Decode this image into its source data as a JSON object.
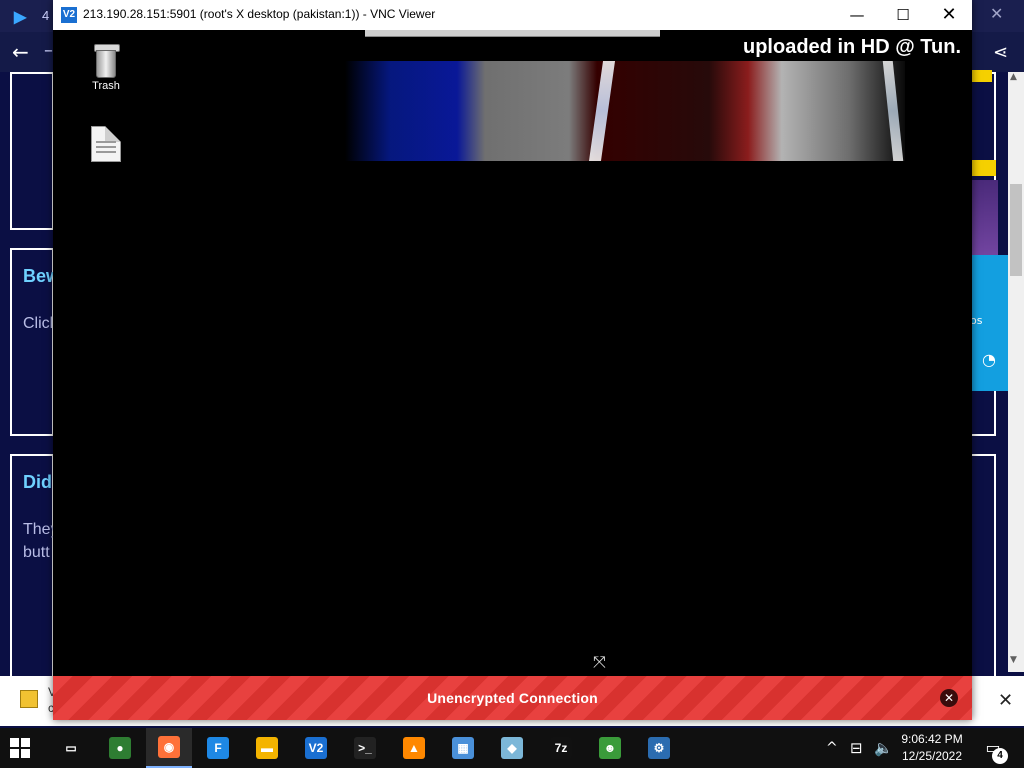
{
  "background_browser": {
    "tab_title_fragment": "4",
    "nav": {
      "back_icon": "arrow-left-icon",
      "share_icon": "share-icon"
    },
    "cards": [
      {
        "title": "Bew",
        "text": "Clicl"
      },
      {
        "title": "Did",
        "text": "They\nbutt"
      }
    ],
    "side_badge": "os",
    "notification": {
      "text_line1": "V",
      "text_line2": "c"
    }
  },
  "vnc_window": {
    "title": "213.190.28.151:5901 (root's X desktop (pakistan:1)) - VNC Viewer",
    "app_icon_text": "V2",
    "controls": {
      "minimize": "—",
      "maximize": "☐",
      "close": "✕"
    },
    "desktop": {
      "overlay_text": "uploaded in HD @ Tun.",
      "icons": [
        {
          "name": "trash",
          "label": "Trash"
        },
        {
          "name": "file",
          "label": ""
        }
      ]
    },
    "warning_banner": {
      "text": "Unencrypted Connection",
      "color": "#e8413f"
    }
  },
  "taskbar": {
    "apps": [
      {
        "name": "task-view",
        "glyph": "▭",
        "color": "#101010"
      },
      {
        "name": "chrome",
        "glyph": "●",
        "color": "#2e7d32"
      },
      {
        "name": "firefox",
        "glyph": "◉",
        "color": "#ff7139"
      },
      {
        "name": "file-manager-f",
        "glyph": "F",
        "color": "#1e88e5"
      },
      {
        "name": "file-explorer",
        "glyph": "▬",
        "color": "#f4b400"
      },
      {
        "name": "vnc-viewer",
        "glyph": "V2",
        "color": "#1a6fd1"
      },
      {
        "name": "terminal",
        "glyph": ">_",
        "color": "#222222"
      },
      {
        "name": "vlc",
        "glyph": "▲",
        "color": "#ff8800"
      },
      {
        "name": "image-viewer",
        "glyph": "▦",
        "color": "#4a90d9"
      },
      {
        "name": "paint-app",
        "glyph": "◆",
        "color": "#7cb7d8"
      },
      {
        "name": "7zip",
        "glyph": "7z",
        "color": "#111111"
      },
      {
        "name": "people-app",
        "glyph": "☻",
        "color": "#3a9b3a"
      },
      {
        "name": "network-tool",
        "glyph": "⚙",
        "color": "#2b6cb0"
      }
    ],
    "tray": {
      "chevron_icon": "^",
      "network_icon": "network-icon",
      "volume_icon": "volume-icon"
    },
    "clock": {
      "time": "9:06:42 PM",
      "date": "12/25/2022"
    },
    "notifications_count": "4"
  }
}
